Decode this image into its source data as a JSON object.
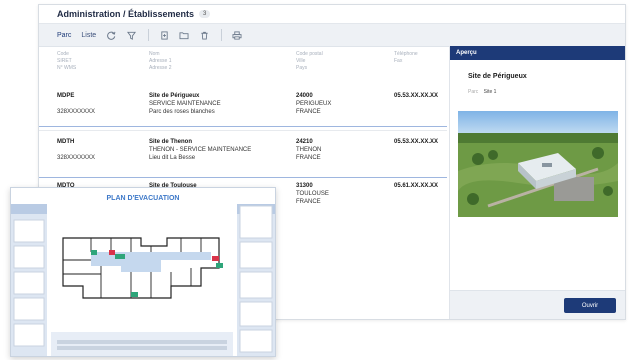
{
  "header": {
    "title": "Administration / Établissements",
    "count": "3"
  },
  "toolbar": {
    "tabs": [
      "Parc",
      "Liste"
    ],
    "icons": [
      "refresh-icon",
      "filter-icon",
      "new-document-icon",
      "folder-icon",
      "trash-icon",
      "print-icon"
    ]
  },
  "table": {
    "columns": [
      [
        "Code",
        "SIRET",
        "N° WMS"
      ],
      [
        "Nom",
        "Adresse 1",
        "Adresse 2"
      ],
      [
        "Code postal",
        "Ville",
        "Pays"
      ],
      [
        "Téléphone",
        "Fax"
      ]
    ],
    "rows": [
      {
        "code": "MDPE",
        "siret": "328XXXXXXX",
        "name": "Site de Périgueux",
        "addr1": "SERVICE MAINTENANCE",
        "addr2": "Parc des roses blanches",
        "cp": "24000",
        "city": "PERIGUEUX",
        "country": "FRANCE",
        "phone": "05.53.XX.XX.XX"
      },
      {
        "code": "MDTH",
        "siret": "328XXXXXXX",
        "name": "Site de Thenon",
        "addr1": "THENON - SERVICE MAINTENANCE",
        "addr2": "Lieu dit La Besse",
        "cp": "24210",
        "city": "THENON",
        "country": "FRANCE",
        "phone": "05.53.XX.XX.XX"
      },
      {
        "code": "MDTO",
        "siret": "",
        "name": "Site de Toulouse",
        "addr1": "",
        "addr2": "",
        "cp": "31300",
        "city": "TOULOUSE",
        "country": "FRANCE",
        "phone": "05.61.XX.XX.XX"
      }
    ]
  },
  "preview": {
    "header": "Aperçu",
    "title": "Site de Périgueux",
    "sub_label": "Parc",
    "sub_value": "Site 1",
    "open_label": "Ouvrir"
  },
  "plan": {
    "title": "PLAN D'EVACUATION"
  },
  "colors": {
    "accent": "#1d3a78",
    "plan_title": "#3d78c8",
    "room": "#c5d8ee",
    "exit": "#2ea57a",
    "alarm": "#d9344a"
  }
}
